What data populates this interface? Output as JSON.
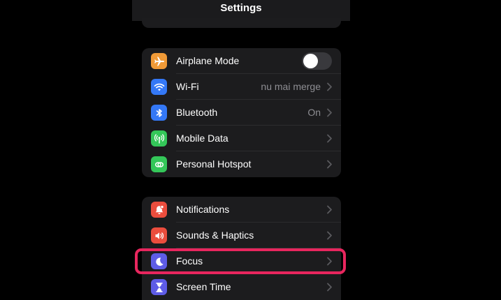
{
  "header": {
    "title": "Settings"
  },
  "connectivity": {
    "items": [
      {
        "label": "Airplane Mode",
        "value": "",
        "icon": "airplane-icon",
        "color": "#f09a37",
        "control": "toggle",
        "toggle_on": false
      },
      {
        "label": "Wi-Fi",
        "value": "nu mai merge",
        "icon": "wifi-icon",
        "color": "#3478f6",
        "control": "chevron"
      },
      {
        "label": "Bluetooth",
        "value": "On",
        "icon": "bluetooth-icon",
        "color": "#3478f6",
        "control": "chevron"
      },
      {
        "label": "Mobile Data",
        "value": "",
        "icon": "antenna-icon",
        "color": "#34c759",
        "control": "chevron"
      },
      {
        "label": "Personal Hotspot",
        "value": "",
        "icon": "hotspot-icon",
        "color": "#34c759",
        "control": "chevron"
      }
    ]
  },
  "notifications_group": {
    "items": [
      {
        "label": "Notifications",
        "icon": "bell-icon",
        "color": "#eb4d3d",
        "control": "chevron"
      },
      {
        "label": "Sounds & Haptics",
        "icon": "speaker-icon",
        "color": "#eb4d3d",
        "control": "chevron"
      },
      {
        "label": "Focus",
        "icon": "moon-icon",
        "color": "#5e5ce6",
        "control": "chevron",
        "highlighted": true
      },
      {
        "label": "Screen Time",
        "icon": "hourglass-icon",
        "color": "#5e5ce6",
        "control": "chevron"
      }
    ]
  },
  "colors": {
    "highlight": "#e8265e",
    "cell_background": "#1c1c1e",
    "secondary_text": "#8e8e93"
  }
}
